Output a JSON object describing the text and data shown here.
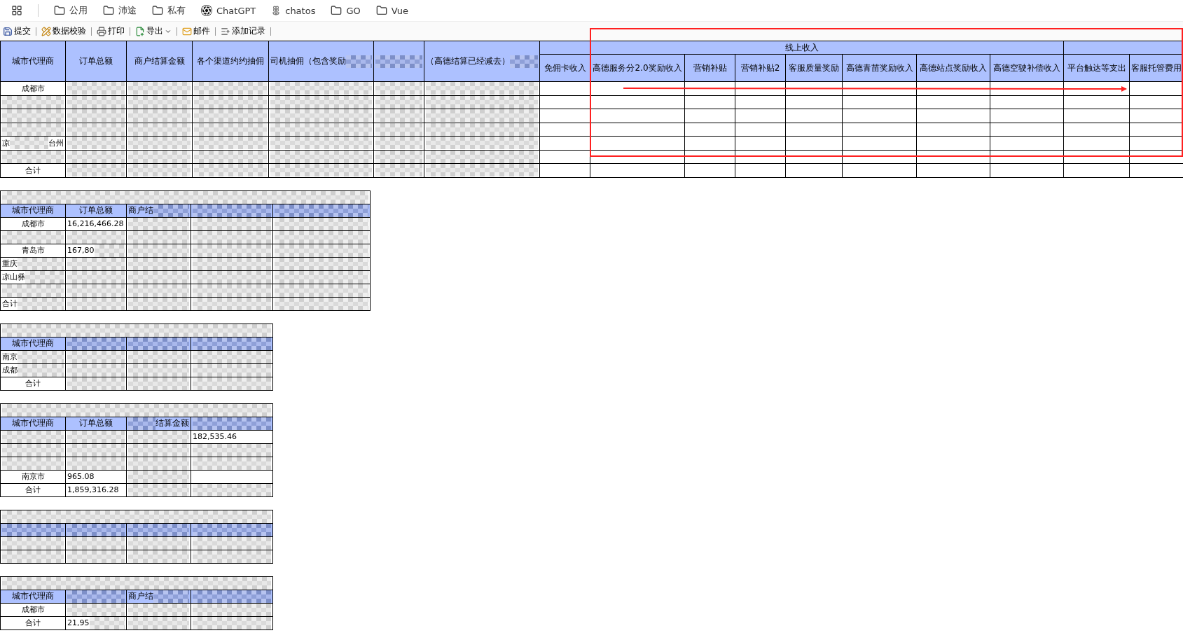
{
  "bookmarks": [
    {
      "kind": "apps"
    },
    {
      "kind": "folder",
      "label": "公用"
    },
    {
      "kind": "folder",
      "label": "沛途"
    },
    {
      "kind": "folder",
      "label": "私有"
    },
    {
      "kind": "chatgpt",
      "label": "ChatGPT"
    },
    {
      "kind": "chatos",
      "label": "chatos"
    },
    {
      "kind": "folder",
      "label": "GO"
    },
    {
      "kind": "folder",
      "label": "Vue"
    }
  ],
  "toolbar": [
    {
      "kind": "save",
      "label": "提交"
    },
    {
      "kind": "check",
      "label": "数据校验"
    },
    {
      "kind": "print",
      "label": "打印"
    },
    {
      "kind": "export",
      "label": "导出",
      "dropdown": true
    },
    {
      "kind": "mail",
      "label": "邮件"
    },
    {
      "kind": "add",
      "label": "添加记录"
    }
  ],
  "main_table": {
    "leading_columns": [
      {
        "label": "城市代理商",
        "redacted": false
      },
      {
        "label": "订单总额",
        "redacted": false
      },
      {
        "label": "商户结算金额",
        "redacted": false
      },
      {
        "label": "各个渠道约约抽佣",
        "redacted": false
      },
      {
        "label": "司机抽佣（包含奖励",
        "redacted": true
      },
      {
        "redacted": true
      },
      {
        "label": "（高德结算已经减去）",
        "redacted": true
      }
    ],
    "column_groups": [
      {
        "label": "线上收入",
        "columns": [
          {
            "label": "免佣卡收入"
          },
          {
            "label": "高德服务分2.0奖励收入"
          },
          {
            "label": "营销补贴"
          },
          {
            "label": "营销补贴2"
          },
          {
            "label": "客服质量奖励"
          },
          {
            "label": "高德青苗奖励收入"
          },
          {
            "label": "高德站点奖励收入"
          },
          {
            "label": "高德空驶补偿收入"
          }
        ]
      },
      {
        "columns": [
          {
            "label": "平台触达等支出"
          },
          {
            "label": "客服托管费用"
          }
        ]
      }
    ],
    "rows": [
      {
        "cells": [
          {
            "text": "成都市",
            "redacted": false
          },
          {
            "redacted": true
          },
          {
            "redacted": true
          },
          {
            "redacted": true
          },
          {
            "redacted": true
          },
          {
            "redacted": true
          },
          {
            "redacted": true
          }
        ]
      },
      {
        "cells": [
          {
            "redacted": true
          },
          {
            "redacted": true
          },
          {
            "redacted": true
          },
          {
            "redacted": true
          },
          {
            "redacted": true
          },
          {
            "redacted": true
          },
          {
            "redacted": true
          }
        ]
      },
      {
        "cells": [
          {
            "redacted": true
          },
          {
            "redacted": true
          },
          {
            "redacted": true
          },
          {
            "redacted": true
          },
          {
            "redacted": true
          },
          {
            "redacted": true
          },
          {
            "redacted": true
          }
        ]
      },
      {
        "cells": [
          {
            "redacted": true
          },
          {
            "redacted": true
          },
          {
            "redacted": true
          },
          {
            "redacted": true
          },
          {
            "redacted": true
          },
          {
            "redacted": true
          },
          {
            "redacted": true
          }
        ]
      },
      {
        "cells": [
          {
            "text": "凉",
            "tail": "台州",
            "redacted": true
          },
          {
            "redacted": true
          },
          {
            "redacted": true
          },
          {
            "redacted": true
          },
          {
            "redacted": true
          },
          {
            "redacted": true
          },
          {
            "redacted": true
          }
        ]
      },
      {
        "cells": [
          {
            "redacted": true
          },
          {
            "redacted": true
          },
          {
            "redacted": true
          },
          {
            "redacted": true
          },
          {
            "redacted": true
          },
          {
            "redacted": true
          },
          {
            "redacted": true
          }
        ]
      },
      {
        "cells": [
          {
            "text": "合计",
            "redacted": false
          },
          {
            "redacted": true
          },
          {
            "redacted": true
          },
          {
            "redacted": true
          },
          {
            "redacted": true
          },
          {
            "redacted": true
          },
          {
            "redacted": true
          }
        ]
      }
    ]
  },
  "annotation": {
    "rectangle": true,
    "arrow": true
  },
  "sub_tables": [
    {
      "title": {
        "redacted": true
      },
      "columns": [
        {
          "label": "城市代理商",
          "redacted": false
        },
        {
          "label": "订单总额",
          "redacted": false
        },
        {
          "label": "商户结",
          "redacted": true
        },
        {
          "redacted": true
        },
        {
          "redacted": true
        }
      ],
      "rows": [
        {
          "cells": [
            {
              "text": "成都市",
              "redacted": false
            },
            {
              "text": "16,216,466.28",
              "redacted": false
            },
            {
              "redacted": true
            },
            {
              "redacted": true
            },
            {
              "redacted": true
            }
          ]
        },
        {
          "cells": [
            {
              "redacted": true
            },
            {
              "redacted": true
            },
            {
              "redacted": true
            },
            {
              "redacted": true
            },
            {
              "redacted": true
            }
          ]
        },
        {
          "cells": [
            {
              "text": "青岛市",
              "redacted": false
            },
            {
              "text": "167,80",
              "redacted": true
            },
            {
              "redacted": true
            },
            {
              "redacted": true
            },
            {
              "redacted": true
            }
          ]
        },
        {
          "cells": [
            {
              "text": "重庆",
              "redacted": true
            },
            {
              "redacted": true
            },
            {
              "redacted": true
            },
            {
              "redacted": true
            },
            {
              "redacted": true
            }
          ]
        },
        {
          "cells": [
            {
              "text": "凉山彝",
              "redacted": true
            },
            {
              "redacted": true
            },
            {
              "redacted": true
            },
            {
              "redacted": true
            },
            {
              "redacted": true
            }
          ]
        },
        {
          "cells": [
            {
              "redacted": true
            },
            {
              "redacted": true
            },
            {
              "redacted": true
            },
            {
              "redacted": true
            },
            {
              "redacted": true
            }
          ]
        },
        {
          "cells": [
            {
              "text": "合计",
              "redacted": true
            },
            {
              "redacted": true
            },
            {
              "redacted": true
            },
            {
              "redacted": true
            },
            {
              "redacted": true
            }
          ]
        }
      ]
    },
    {
      "title": {
        "redacted": true
      },
      "columns": [
        {
          "label": "城市代理商",
          "redacted": false
        },
        {
          "redacted": true
        },
        {
          "redacted": true
        },
        {
          "redacted": true
        }
      ],
      "rows": [
        {
          "cells": [
            {
              "text": "南京",
              "redacted": true
            },
            {
              "redacted": true
            },
            {
              "redacted": true
            },
            {
              "redacted": true
            }
          ]
        },
        {
          "cells": [
            {
              "text": "成都",
              "redacted": true
            },
            {
              "redacted": true
            },
            {
              "redacted": true
            },
            {
              "redacted": true
            }
          ]
        },
        {
          "cells": [
            {
              "text": "合计",
              "redacted": false
            },
            {
              "redacted": true
            },
            {
              "redacted": true
            },
            {
              "redacted": true
            }
          ]
        }
      ]
    },
    {
      "title": {
        "redacted": true
      },
      "columns": [
        {
          "label": "城市代理商",
          "redacted": false
        },
        {
          "label": "订单总额",
          "redacted": false
        },
        {
          "tail": "结算金额",
          "redacted": true
        },
        {
          "redacted": true
        }
      ],
      "rows": [
        {
          "cells": [
            {
              "redacted": true
            },
            {
              "redacted": true
            },
            {
              "redacted": true
            },
            {
              "text": "182,535.46",
              "redacted": false
            }
          ]
        },
        {
          "cells": [
            {
              "redacted": true
            },
            {
              "redacted": true
            },
            {
              "redacted": true
            },
            {
              "redacted": true
            }
          ]
        },
        {
          "cells": [
            {
              "redacted": true
            },
            {
              "redacted": true
            },
            {
              "redacted": true
            },
            {
              "redacted": true
            }
          ]
        },
        {
          "cells": [
            {
              "text": "南京市",
              "redacted": false
            },
            {
              "text": "965.08",
              "redacted": false
            },
            {
              "redacted": true
            },
            {
              "redacted": false
            }
          ]
        },
        {
          "cells": [
            {
              "text": "合计",
              "redacted": false
            },
            {
              "text": "1,859,316.28",
              "redacted": false
            },
            {
              "redacted": true
            },
            {
              "redacted": true
            }
          ]
        }
      ]
    },
    {
      "title": {
        "redacted": true
      },
      "columns": [
        {
          "redacted": true
        },
        {
          "redacted": true
        },
        {
          "redacted": true
        },
        {
          "redacted": true
        }
      ],
      "rows": [
        {
          "cells": [
            {
              "redacted": true
            },
            {
              "redacted": true
            },
            {
              "redacted": true
            },
            {
              "redacted": true
            }
          ]
        },
        {
          "cells": [
            {
              "redacted": true
            },
            {
              "redacted": true
            },
            {
              "redacted": true
            },
            {
              "redacted": true
            }
          ]
        }
      ]
    },
    {
      "title": {
        "redacted": true
      },
      "columns": [
        {
          "label": "城市代理商",
          "redacted": false
        },
        {
          "redacted": true
        },
        {
          "label": "商户结",
          "redacted": true
        },
        {
          "redacted": true
        }
      ],
      "rows": [
        {
          "cells": [
            {
              "text": "成都市",
              "redacted": false
            },
            {
              "redacted": true
            },
            {
              "redacted": true
            },
            {
              "redacted": true
            }
          ]
        },
        {
          "cells": [
            {
              "text": "合计",
              "redacted": false
            },
            {
              "text": "21,95",
              "redacted": true
            },
            {
              "redacted": true
            },
            {
              "redacted": true
            }
          ]
        }
      ]
    }
  ]
}
